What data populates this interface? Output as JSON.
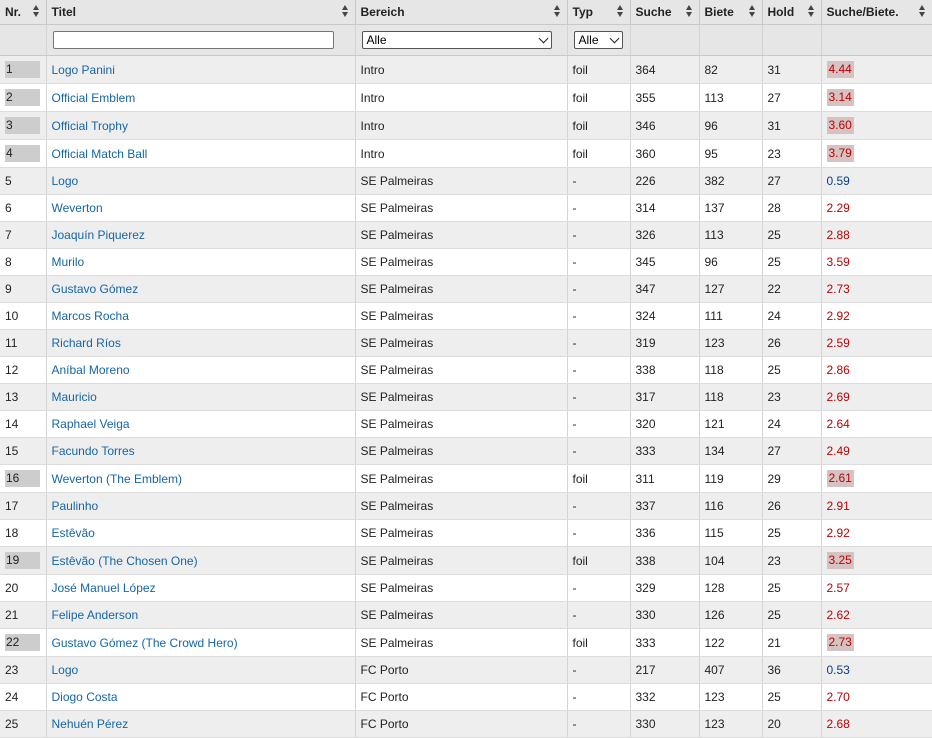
{
  "headers": {
    "nr": "Nr.",
    "titel": "Titel",
    "bereich": "Bereich",
    "typ": "Typ",
    "suche": "Suche",
    "biete": "Biete",
    "hold": "Hold",
    "ratio": "Suche/Biete."
  },
  "filters": {
    "titel_value": "",
    "bereich_selected": "Alle",
    "typ_selected": "Alle"
  },
  "colors": {
    "ratio_below_one": "#0a3d86",
    "ratio_above_one": "#c00000",
    "link": "#1565a8"
  },
  "rows": [
    {
      "nr": "1",
      "titel": "Logo Panini",
      "bereich": "Intro",
      "typ": "foil",
      "suche": "364",
      "biete": "82",
      "hold": "31",
      "ratio": "4.44",
      "highlight": true
    },
    {
      "nr": "2",
      "titel": "Official Emblem",
      "bereich": "Intro",
      "typ": "foil",
      "suche": "355",
      "biete": "113",
      "hold": "27",
      "ratio": "3.14",
      "highlight": true
    },
    {
      "nr": "3",
      "titel": "Official Trophy",
      "bereich": "Intro",
      "typ": "foil",
      "suche": "346",
      "biete": "96",
      "hold": "31",
      "ratio": "3.60",
      "highlight": true
    },
    {
      "nr": "4",
      "titel": "Official Match Ball",
      "bereich": "Intro",
      "typ": "foil",
      "suche": "360",
      "biete": "95",
      "hold": "23",
      "ratio": "3.79",
      "highlight": true
    },
    {
      "nr": "5",
      "titel": "Logo",
      "bereich": "SE Palmeiras",
      "typ": "-",
      "suche": "226",
      "biete": "382",
      "hold": "27",
      "ratio": "0.59",
      "highlight": false
    },
    {
      "nr": "6",
      "titel": "Weverton",
      "bereich": "SE Palmeiras",
      "typ": "-",
      "suche": "314",
      "biete": "137",
      "hold": "28",
      "ratio": "2.29",
      "highlight": false
    },
    {
      "nr": "7",
      "titel": "Joaquín Piquerez",
      "bereich": "SE Palmeiras",
      "typ": "-",
      "suche": "326",
      "biete": "113",
      "hold": "25",
      "ratio": "2.88",
      "highlight": false
    },
    {
      "nr": "8",
      "titel": "Murilo",
      "bereich": "SE Palmeiras",
      "typ": "-",
      "suche": "345",
      "biete": "96",
      "hold": "25",
      "ratio": "3.59",
      "highlight": false
    },
    {
      "nr": "9",
      "titel": "Gustavo Gómez",
      "bereich": "SE Palmeiras",
      "typ": "-",
      "suche": "347",
      "biete": "127",
      "hold": "22",
      "ratio": "2.73",
      "highlight": false
    },
    {
      "nr": "10",
      "titel": "Marcos Rocha",
      "bereich": "SE Palmeiras",
      "typ": "-",
      "suche": "324",
      "biete": "111",
      "hold": "24",
      "ratio": "2.92",
      "highlight": false
    },
    {
      "nr": "11",
      "titel": "Richard Ríos",
      "bereich": "SE Palmeiras",
      "typ": "-",
      "suche": "319",
      "biete": "123",
      "hold": "26",
      "ratio": "2.59",
      "highlight": false
    },
    {
      "nr": "12",
      "titel": "Aníbal Moreno",
      "bereich": "SE Palmeiras",
      "typ": "-",
      "suche": "338",
      "biete": "118",
      "hold": "25",
      "ratio": "2.86",
      "highlight": false
    },
    {
      "nr": "13",
      "titel": "Mauricio",
      "bereich": "SE Palmeiras",
      "typ": "-",
      "suche": "317",
      "biete": "118",
      "hold": "23",
      "ratio": "2.69",
      "highlight": false
    },
    {
      "nr": "14",
      "titel": "Raphael Veiga",
      "bereich": "SE Palmeiras",
      "typ": "-",
      "suche": "320",
      "biete": "121",
      "hold": "24",
      "ratio": "2.64",
      "highlight": false
    },
    {
      "nr": "15",
      "titel": "Facundo Torres",
      "bereich": "SE Palmeiras",
      "typ": "-",
      "suche": "333",
      "biete": "134",
      "hold": "27",
      "ratio": "2.49",
      "highlight": false
    },
    {
      "nr": "16",
      "titel": "Weverton (The Emblem)",
      "bereich": "SE Palmeiras",
      "typ": "foil",
      "suche": "311",
      "biete": "119",
      "hold": "29",
      "ratio": "2.61",
      "highlight": true
    },
    {
      "nr": "17",
      "titel": "Paulinho",
      "bereich": "SE Palmeiras",
      "typ": "-",
      "suche": "337",
      "biete": "116",
      "hold": "26",
      "ratio": "2.91",
      "highlight": false
    },
    {
      "nr": "18",
      "titel": "Estêvão",
      "bereich": "SE Palmeiras",
      "typ": "-",
      "suche": "336",
      "biete": "115",
      "hold": "25",
      "ratio": "2.92",
      "highlight": false
    },
    {
      "nr": "19",
      "titel": "Estêvão (The Chosen One)",
      "bereich": "SE Palmeiras",
      "typ": "foil",
      "suche": "338",
      "biete": "104",
      "hold": "23",
      "ratio": "3.25",
      "highlight": true
    },
    {
      "nr": "20",
      "titel": "José Manuel López",
      "bereich": "SE Palmeiras",
      "typ": "-",
      "suche": "329",
      "biete": "128",
      "hold": "25",
      "ratio": "2.57",
      "highlight": false
    },
    {
      "nr": "21",
      "titel": "Felipe Anderson",
      "bereich": "SE Palmeiras",
      "typ": "-",
      "suche": "330",
      "biete": "126",
      "hold": "25",
      "ratio": "2.62",
      "highlight": false
    },
    {
      "nr": "22",
      "titel": "Gustavo Gómez (The Crowd Hero)",
      "bereich": "SE Palmeiras",
      "typ": "foil",
      "suche": "333",
      "biete": "122",
      "hold": "21",
      "ratio": "2.73",
      "highlight": true
    },
    {
      "nr": "23",
      "titel": "Logo",
      "bereich": "FC Porto",
      "typ": "-",
      "suche": "217",
      "biete": "407",
      "hold": "36",
      "ratio": "0.53",
      "highlight": false
    },
    {
      "nr": "24",
      "titel": "Diogo Costa",
      "bereich": "FC Porto",
      "typ": "-",
      "suche": "332",
      "biete": "123",
      "hold": "25",
      "ratio": "2.70",
      "highlight": false
    },
    {
      "nr": "25",
      "titel": "Nehuén Pérez",
      "bereich": "FC Porto",
      "typ": "-",
      "suche": "330",
      "biete": "123",
      "hold": "20",
      "ratio": "2.68",
      "highlight": false
    }
  ]
}
